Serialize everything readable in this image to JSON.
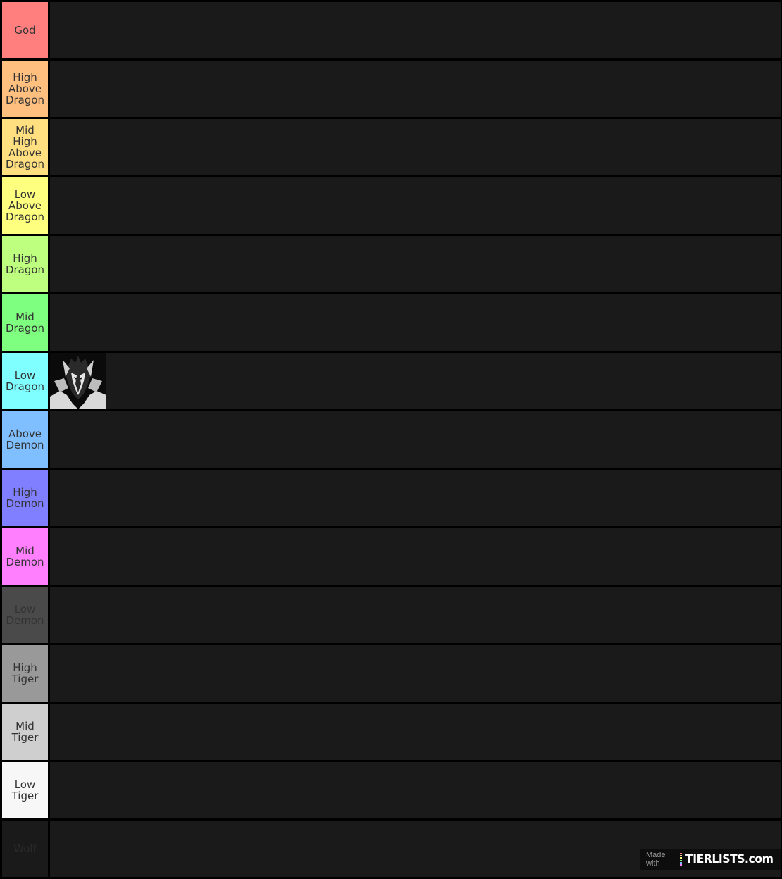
{
  "tiers": [
    {
      "label": "God",
      "color": "#ff7f7f",
      "text_color": "#333333"
    },
    {
      "label": "High\nAbove\nDragon",
      "color": "#ffbf7f",
      "text_color": "#333333"
    },
    {
      "label": "Mid\nHigh\nAbove\nDragon",
      "color": "#ffdf7f",
      "text_color": "#333333"
    },
    {
      "label": "Low\nAbove\nDragon",
      "color": "#ffff7f",
      "text_color": "#333333"
    },
    {
      "label": "High\nDragon",
      "color": "#bfff7f",
      "text_color": "#333333"
    },
    {
      "label": "Mid\nDragon",
      "color": "#7fff7f",
      "text_color": "#333333"
    },
    {
      "label": "Low\nDragon",
      "color": "#7fffff",
      "text_color": "#333333"
    },
    {
      "label": "Above\nDemon",
      "color": "#7fbfff",
      "text_color": "#333333"
    },
    {
      "label": "High\nDemon",
      "color": "#7f7fff",
      "text_color": "#333333"
    },
    {
      "label": "Mid\nDemon",
      "color": "#ff7fff",
      "text_color": "#333333"
    },
    {
      "label": "Low\nDemon",
      "color": "#4a4a4a",
      "text_color": "#333333"
    },
    {
      "label": "High\nTiger",
      "color": "#999999",
      "text_color": "#333333"
    },
    {
      "label": "Mid\nTiger",
      "color": "#cfcfcf",
      "text_color": "#333333"
    },
    {
      "label": "Low\nTiger",
      "color": "#f7f7f7",
      "text_color": "#333333"
    },
    {
      "label": "Wolf",
      "color": "#1a1a1a",
      "text_color": "#2a2a2a"
    }
  ],
  "placed_items": [
    {
      "tier": "Low\nDragon",
      "icon": "manga-character-portrait"
    }
  ],
  "watermark": {
    "made_with": "Made with",
    "logo": "TIERLISTS.com",
    "bar_colors": [
      "#ff7f7f",
      "#ffbf7f",
      "#ffff7f",
      "#7fff7f",
      "#7fbfff",
      "#ff7fff"
    ]
  }
}
